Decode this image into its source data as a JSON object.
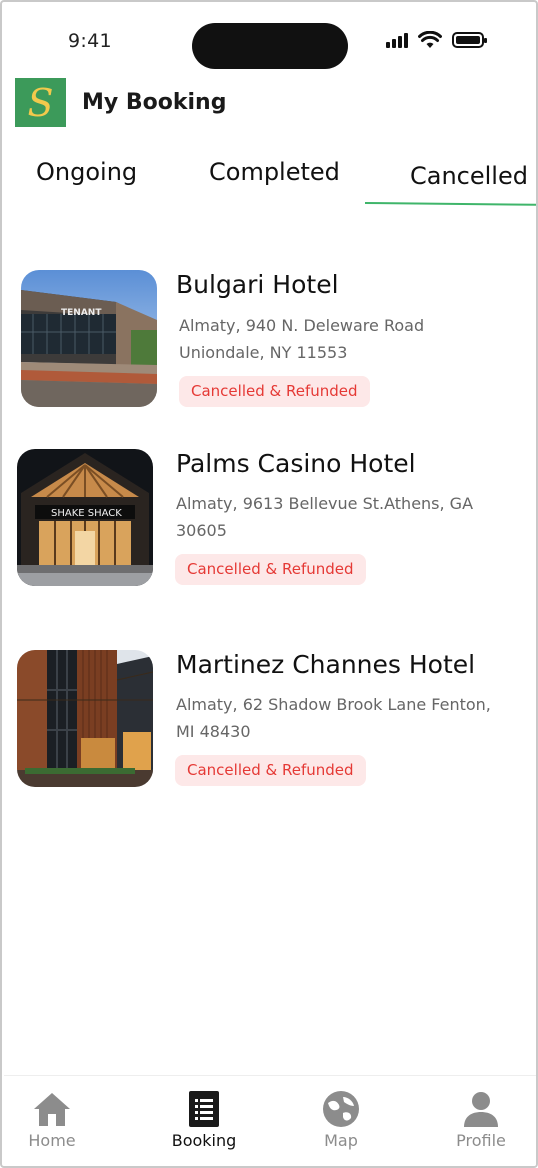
{
  "status_bar": {
    "time": "9:41"
  },
  "header": {
    "logo_letter": "S",
    "title": "My Booking"
  },
  "tabs": [
    {
      "label": "Ongoing",
      "active": false
    },
    {
      "label": "Completed",
      "active": false
    },
    {
      "label": "Cancelled",
      "active": true
    }
  ],
  "bookings": [
    {
      "name": "Bulgari Hotel",
      "address": "Almaty, 940 N. Deleware Road Uniondale, NY 11553",
      "status": "Cancelled & Refunded",
      "image_sign": "TENANT"
    },
    {
      "name": "Palms Casino Hotel",
      "address": "Almaty, 9613 Bellevue St.Athens, GA 30605",
      "status": "Cancelled & Refunded",
      "image_sign": "SHAKE SHACK"
    },
    {
      "name": "Martinez Channes Hotel",
      "address": "Almaty, 62 Shadow Brook Lane Fenton, MI 48430",
      "status": "Cancelled & Refunded"
    }
  ],
  "bottom_nav": [
    {
      "label": "Home",
      "icon": "home-icon",
      "active": false
    },
    {
      "label": "Booking",
      "icon": "booking-list-icon",
      "active": true
    },
    {
      "label": "Map",
      "icon": "globe-map-icon",
      "active": false
    },
    {
      "label": "Profile",
      "icon": "profile-icon",
      "active": false
    }
  ],
  "colors": {
    "accent": "#3fb56a",
    "logo_bg": "#3c9a5a",
    "logo_letter": "#f2c94c",
    "badge_bg": "#fde8e8",
    "badge_text": "#e53935",
    "inactive_nav": "#8c8c8c"
  }
}
